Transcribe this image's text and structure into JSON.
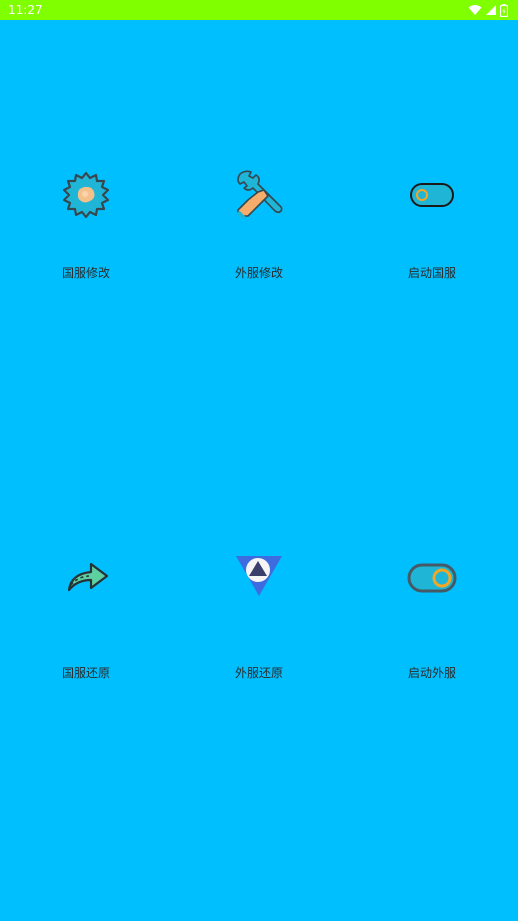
{
  "status_bar": {
    "time": "11:27",
    "icons": [
      "wifi-icon",
      "cellular-signal-icon",
      "battery-icon"
    ],
    "background": "#80FF00"
  },
  "colors": {
    "page_background": "#00BFFF",
    "label_text": "#2b2b2b"
  },
  "tiles": [
    {
      "label": "国服修改",
      "icon": "gear-icon"
    },
    {
      "label": "外服修改",
      "icon": "wrench-icon"
    },
    {
      "label": "启动国服",
      "icon": "toggle-off-icon"
    },
    {
      "label": "国服还原",
      "icon": "share-arrow-icon"
    },
    {
      "label": "外服还原",
      "icon": "triangle-icon"
    },
    {
      "label": "启动外服",
      "icon": "toggle-on-icon"
    }
  ]
}
